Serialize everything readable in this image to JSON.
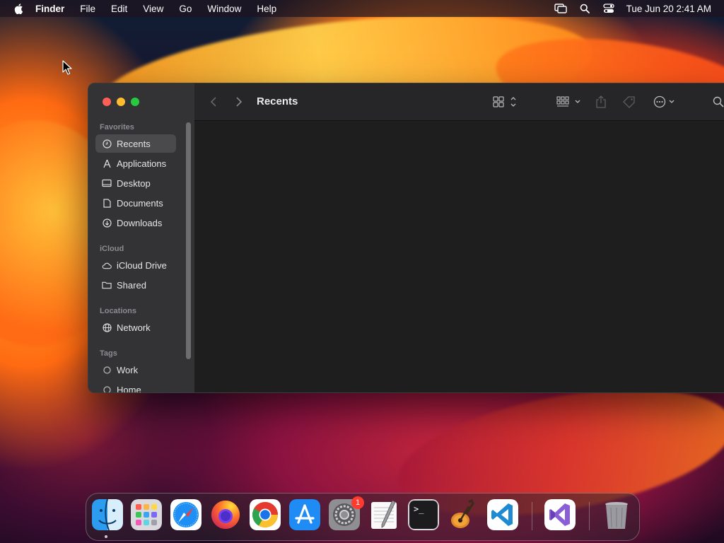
{
  "menubar": {
    "apple_icon": "apple-logo-icon",
    "app_name": "Finder",
    "items": [
      "File",
      "Edit",
      "View",
      "Go",
      "Window",
      "Help"
    ],
    "status_icons": [
      "screen-mirroring-icon",
      "spotlight-search-icon",
      "control-center-icon"
    ],
    "datetime": "Tue Jun 20  2:41 AM"
  },
  "finder": {
    "title": "Recents",
    "toolbar_icons": [
      "back-icon",
      "forward-icon",
      "view-mode-icon",
      "group-by-icon",
      "share-icon",
      "tag-icon",
      "more-actions-icon",
      "search-icon"
    ],
    "sidebar": {
      "favorites_label": "Favorites",
      "favorites": [
        {
          "label": "Recents",
          "icon": "clock-icon",
          "active": true
        },
        {
          "label": "Applications",
          "icon": "applications-icon"
        },
        {
          "label": "Desktop",
          "icon": "desktop-icon"
        },
        {
          "label": "Documents",
          "icon": "document-icon"
        },
        {
          "label": "Downloads",
          "icon": "download-icon"
        }
      ],
      "icloud_label": "iCloud",
      "icloud": [
        {
          "label": "iCloud Drive",
          "icon": "cloud-icon"
        },
        {
          "label": "Shared",
          "icon": "shared-folder-icon"
        }
      ],
      "locations_label": "Locations",
      "locations": [
        {
          "label": "Network",
          "icon": "globe-icon"
        }
      ],
      "tags_label": "Tags",
      "tags": [
        {
          "label": "Work",
          "icon": "tag-circle-icon"
        },
        {
          "label": "Home",
          "icon": "tag-circle-icon"
        }
      ]
    }
  },
  "dock": {
    "apps": [
      {
        "name": "Finder",
        "icon": "finder-icon",
        "running": true
      },
      {
        "name": "Launchpad",
        "icon": "launchpad-icon"
      },
      {
        "name": "Safari",
        "icon": "safari-icon"
      },
      {
        "name": "Firefox",
        "icon": "firefox-icon"
      },
      {
        "name": "Chrome",
        "icon": "chrome-icon"
      },
      {
        "name": "App Store",
        "icon": "app-store-icon"
      },
      {
        "name": "System Settings",
        "icon": "system-settings-icon",
        "badge": "1"
      },
      {
        "name": "TextEdit",
        "icon": "textedit-icon"
      },
      {
        "name": "Terminal",
        "icon": "terminal-icon",
        "glyph": ">_"
      },
      {
        "name": "GarageBand",
        "icon": "garageband-icon"
      },
      {
        "name": "Visual Studio Code",
        "icon": "vscode-icon"
      },
      {
        "name": "Visual Studio",
        "icon": "visual-studio-icon"
      },
      {
        "name": "Trash",
        "icon": "trash-icon"
      }
    ]
  },
  "colors": {
    "close": "#ff5f57",
    "minimize": "#febc2e",
    "maximize": "#28c840",
    "badge": "#ff3b30"
  }
}
